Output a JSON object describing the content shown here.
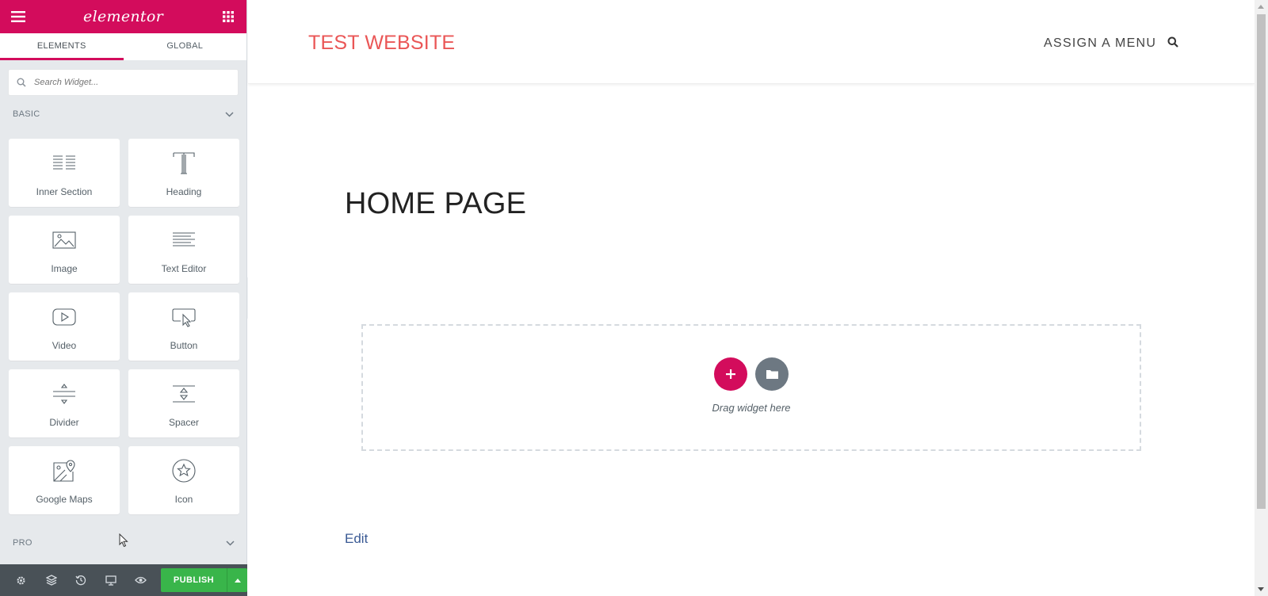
{
  "panel": {
    "logo": "elementor",
    "tabs": [
      {
        "label": "ELEMENTS",
        "active": true
      },
      {
        "label": "GLOBAL",
        "active": false
      }
    ],
    "search": {
      "placeholder": "Search Widget..."
    },
    "categories": {
      "basic": "BASIC",
      "pro": "PRO"
    },
    "widgets": [
      {
        "label": "Inner Section",
        "icon": "inner-section-icon"
      },
      {
        "label": "Heading",
        "icon": "heading-icon"
      },
      {
        "label": "Image",
        "icon": "image-icon"
      },
      {
        "label": "Text Editor",
        "icon": "text-editor-icon"
      },
      {
        "label": "Video",
        "icon": "video-icon"
      },
      {
        "label": "Button",
        "icon": "button-icon"
      },
      {
        "label": "Divider",
        "icon": "divider-icon"
      },
      {
        "label": "Spacer",
        "icon": "spacer-icon"
      },
      {
        "label": "Google Maps",
        "icon": "google-maps-icon"
      },
      {
        "label": "Icon",
        "icon": "star-icon"
      }
    ],
    "footer": {
      "publish_label": "PUBLISH",
      "icons": [
        "settings-icon",
        "navigator-icon",
        "history-icon",
        "responsive-icon",
        "preview-icon"
      ]
    }
  },
  "preview": {
    "site_title": "TEST WEBSITE",
    "menu_label": "ASSIGN A MENU",
    "page_title": "HOME PAGE",
    "drop_zone_text": "Drag widget here",
    "edit_link": "Edit"
  },
  "colors": {
    "brand": "#d30c5c",
    "publish": "#39b54a",
    "site_title": "#ea5656",
    "footer_bg": "#495157"
  }
}
